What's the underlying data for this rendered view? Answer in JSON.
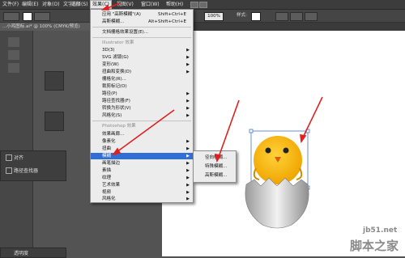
{
  "menubar": {
    "items": [
      "文件(F)",
      "编辑(E)",
      "对象(O)",
      "文字(T)",
      "选择(S)",
      "效果(C)",
      "视图(V)",
      "窗口(W)",
      "帮助(H)"
    ],
    "active_index": 5
  },
  "control": {
    "zoom": "100%",
    "style_label": "样式:",
    "opacity_label": "透明"
  },
  "doc_tab": "...小鸡图标.ai* @ 100% (CMYK/预览)",
  "effect_menu": {
    "apply_last": {
      "label": "应用 \"高斯模糊\"(A)",
      "shortcut": "Shift+Ctrl+E"
    },
    "last_effect": {
      "label": "高斯模糊...",
      "shortcut": "Alt+Shift+Ctrl+E"
    },
    "raster_settings": "文档栅格效果设置(E)...",
    "illustrator_header": "Illustrator 效果",
    "illustrator_items": [
      "3D(3)",
      "SVG 滤镜(G)",
      "变形(W)",
      "扭曲和变换(D)",
      "栅格化(R)...",
      "裁剪标记(O)",
      "路径(P)",
      "路径查找器(F)",
      "转换为形状(V)",
      "风格化(S)"
    ],
    "photoshop_header": "Photoshop 效果",
    "photoshop_items": [
      "效果画廊...",
      "像素化",
      "扭曲",
      "模糊",
      "画笔描边",
      "素描",
      "纹理",
      "艺术效果",
      "视频",
      "风格化"
    ],
    "highlighted_index": 3
  },
  "blur_submenu": {
    "items": [
      "径向模糊...",
      "特殊模糊...",
      "高斯模糊..."
    ]
  },
  "panels": {
    "align_label": "对齐",
    "pathfinder_label": "路径查找器",
    "transparency_label": "透明度"
  },
  "watermark": {
    "domain": "jb51.net",
    "name": "脚本之家"
  },
  "colors": {
    "accent": "#2f6fd6",
    "arrow": "#e02020",
    "chick": "#f7b81d"
  }
}
